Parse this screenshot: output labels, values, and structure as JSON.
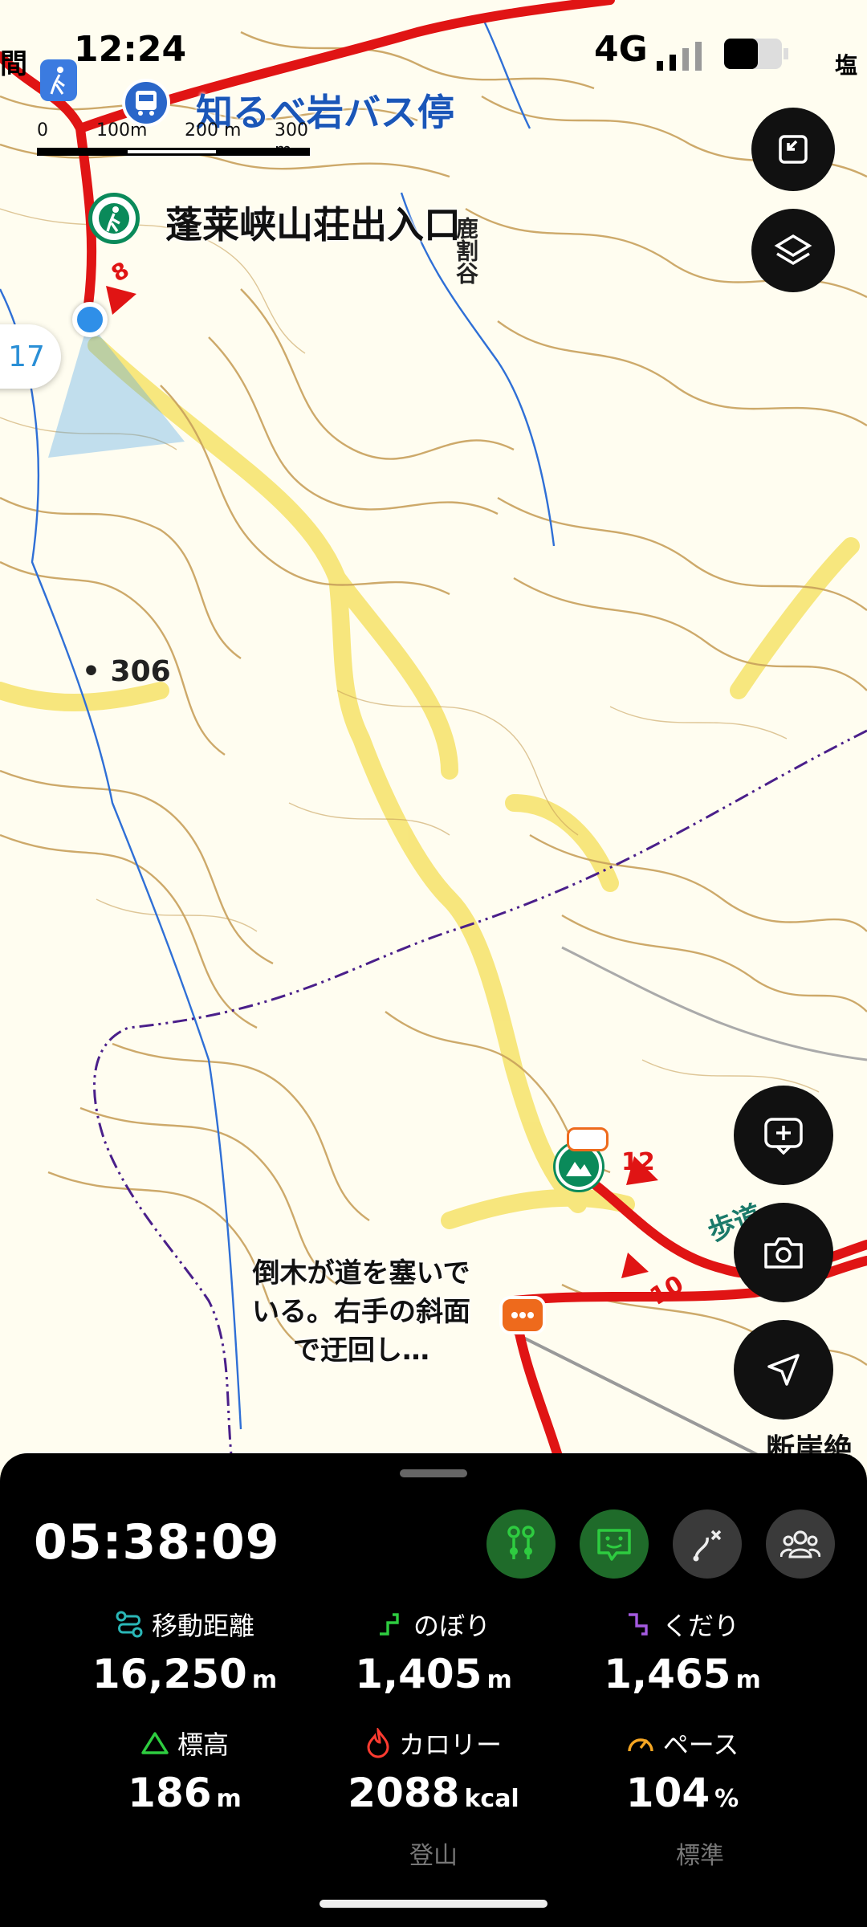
{
  "status_bar": {
    "time": "12:24",
    "network": "4G",
    "edge_left": "間",
    "edge_right": "塩"
  },
  "map": {
    "bus_stop": "知るべ岩バス停",
    "trail_entrance": "蓬莱峡山荘出入口",
    "valley_name": "鹿割谷",
    "elevation_point": "306",
    "cliff_label": "断崖絶",
    "road_label_fragment": "歩道",
    "trail_note": "倒木が道を塞いでいる。右手の斜面で迂回し…",
    "bearing": "17",
    "route_marker_1": "8",
    "route_marker_2": "10",
    "route_marker_3": "12",
    "scale": {
      "t0": "0",
      "t1": "100m",
      "t2": "200 m",
      "t3": "300 m"
    },
    "buttons": [
      "fullscreen-exit",
      "layers",
      "add-memo",
      "camera",
      "locate"
    ]
  },
  "tracking": {
    "elapsed_time": "05:38:09",
    "modes": [
      "route-check",
      "face-mode",
      "off-route",
      "group"
    ],
    "stats": [
      {
        "label": "移動距離",
        "value": "16,250",
        "unit": "m",
        "icon": "route-icon"
      },
      {
        "label": "のぼり",
        "value": "1,405",
        "unit": "m",
        "icon": "ascent-icon"
      },
      {
        "label": "くだり",
        "value": "1,465",
        "unit": "m",
        "icon": "descent-icon"
      },
      {
        "label": "標高",
        "value": "186",
        "unit": "m",
        "icon": "mountain-icon"
      },
      {
        "label": "カロリー",
        "value": "2088",
        "unit": "kcal",
        "icon": "flame-icon"
      },
      {
        "label": "ペース",
        "value": "104",
        "unit": "%",
        "icon": "gauge-icon"
      }
    ],
    "activity_type": "登山",
    "pace_level": "標準"
  },
  "colors": {
    "route_red": "#e01414",
    "trail_yellow": "#f6e36a",
    "contour_brown": "#c8a15c",
    "river_blue": "#2f6fd6",
    "accent_green": "#2ecc40",
    "icon_teal": "#2ab7b7"
  }
}
